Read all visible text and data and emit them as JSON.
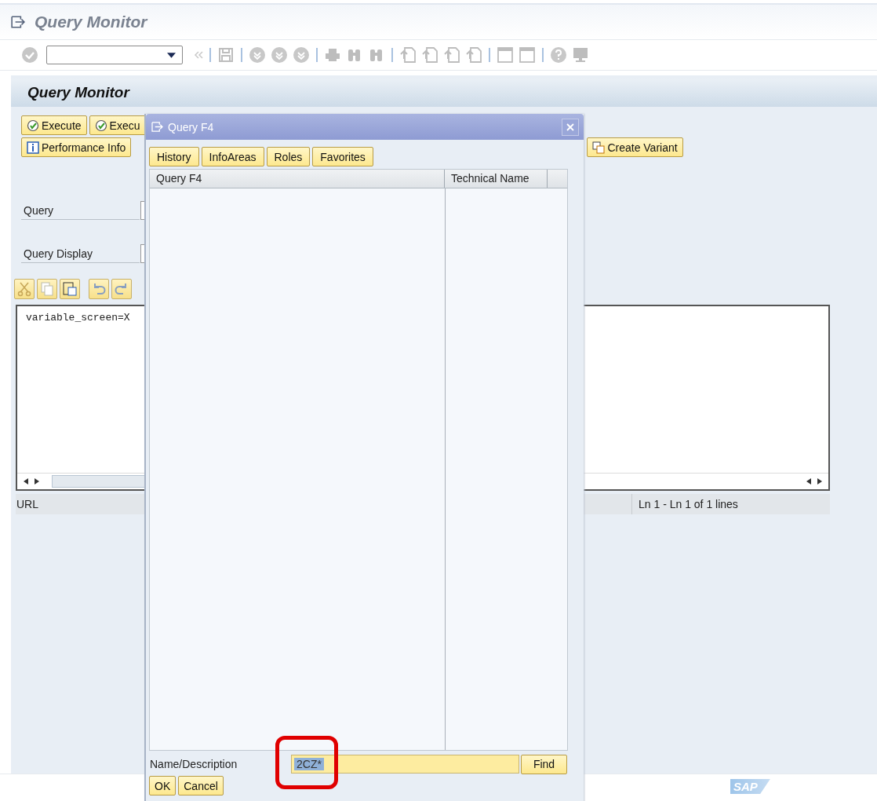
{
  "window": {
    "title": "Query Monitor"
  },
  "header": {
    "title": "Query Monitor"
  },
  "buttons": [
    {
      "label": "Execute"
    },
    {
      "label": "Execu"
    },
    {
      "label": "Performance Info"
    },
    {
      "label": "Create Variant"
    }
  ],
  "form": [
    {
      "label": "Query"
    },
    {
      "label": "Query Display"
    }
  ],
  "editor": {
    "lines": [
      "variable_screen=X"
    ],
    "status_left": "URL",
    "status_right": "Ln 1 - Ln 1 of 1 lines"
  },
  "dialog": {
    "title": "Query F4",
    "tabs": [
      {
        "label": "History"
      },
      {
        "label": "InfoAreas"
      },
      {
        "label": "Roles"
      },
      {
        "label": "Favorites"
      }
    ],
    "columns": [
      "Query F4",
      "Technical Name"
    ],
    "search": {
      "label": "Name/Description",
      "value": "2CZ*",
      "button": "Find"
    },
    "buttons": [
      "OK",
      "Cancel"
    ]
  },
  "logo": "SAP"
}
